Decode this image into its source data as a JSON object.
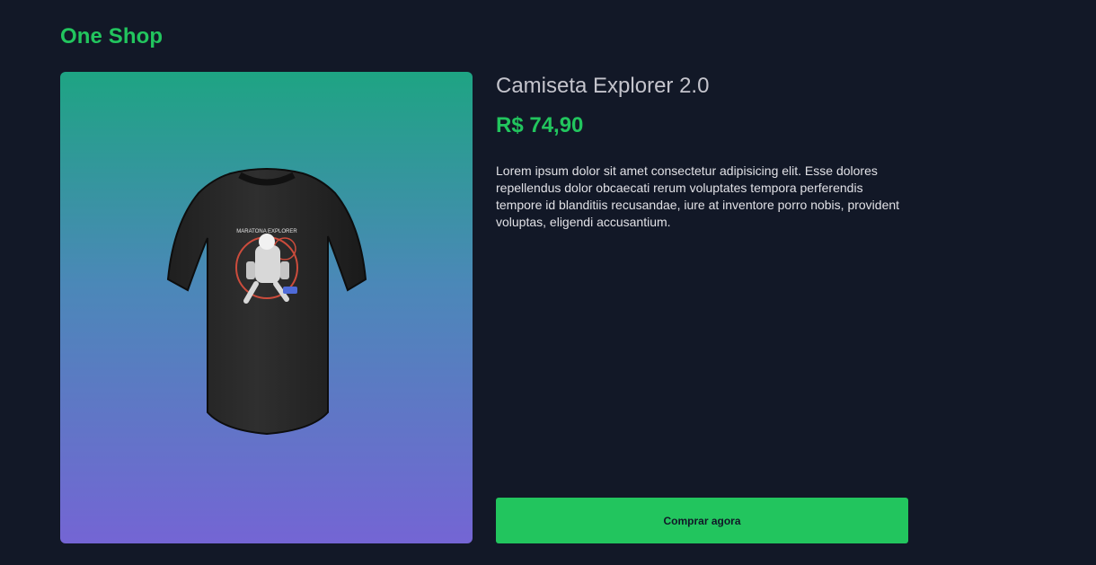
{
  "header": {
    "logo_text": "One Shop"
  },
  "product": {
    "title": "Camiseta Explorer 2.0",
    "price": "R$ 74,90",
    "description": "Lorem ipsum dolor sit amet consectetur adipisicing elit. Esse dolores repellendus dolor obcaecati rerum voluptates tempora perferendis tempore id blanditiis recusandae, iure at inventore porro nobis, provident voluptas, eligendi accusantium.",
    "image_text": "MARATONA EXPLORER",
    "button_label": "Comprar agora"
  },
  "colors": {
    "background": "#121827",
    "brand": "#22c55e",
    "text_primary": "#e1e1e6",
    "text_secondary": "#c4c4cc",
    "image_gradient_top": "#1ea483",
    "image_gradient_bottom": "#7465d4"
  }
}
